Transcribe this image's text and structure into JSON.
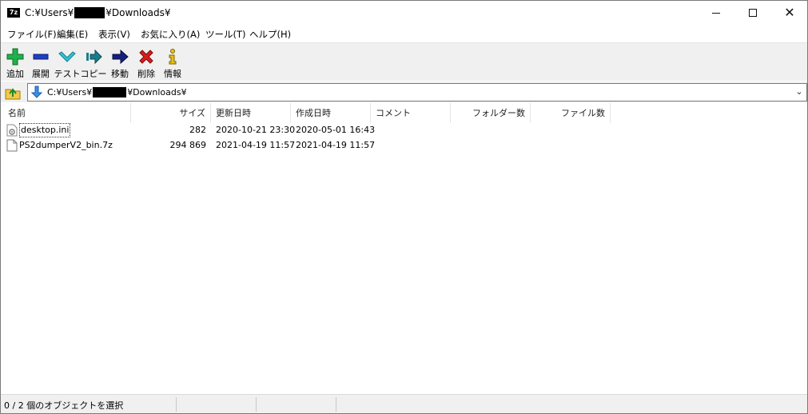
{
  "window": {
    "app_icon_text": "7z",
    "title_prefix": "C:¥Users¥",
    "title_suffix": "¥Downloads¥"
  },
  "menu": [
    {
      "label": "ファイル(F)"
    },
    {
      "label": "編集(E)"
    },
    {
      "label": "表示(V)"
    },
    {
      "label": "お気に入り(A)"
    },
    {
      "label": "ツール(T)"
    },
    {
      "label": "ヘルプ(H)"
    }
  ],
  "toolbar": {
    "add": "追加",
    "extract": "展開",
    "test": "テスト",
    "copy": "コピー",
    "move": "移動",
    "delete": "削除",
    "info": "情報"
  },
  "address": {
    "prefix": "C:¥Users¥",
    "suffix": "¥Downloads¥"
  },
  "columns": {
    "name": "名前",
    "size": "サイズ",
    "modified": "更新日時",
    "created": "作成日時",
    "comment": "コメント",
    "folders": "フォルダー数",
    "files": "ファイル数"
  },
  "files": [
    {
      "name": "desktop.ini",
      "size": "282",
      "modified": "2020-10-21 23:30",
      "created": "2020-05-01 16:43",
      "icon": "settings-file-icon"
    },
    {
      "name": "PS2dumperV2_bin.7z",
      "size": "294 869",
      "modified": "2021-04-19 11:57",
      "created": "2021-04-19 11:57",
      "icon": "file-icon"
    }
  ],
  "status": {
    "text": "0 / 2 個のオブジェクトを選択"
  },
  "colors": {
    "toolbar_bg": "#f0f0f0",
    "add_green": "#22b14c",
    "extract_blue": "#1e3fbf",
    "test_cyan": "#2fc6d6",
    "delete_red": "#d81e1e",
    "info_yellow": "#e8c21a"
  }
}
